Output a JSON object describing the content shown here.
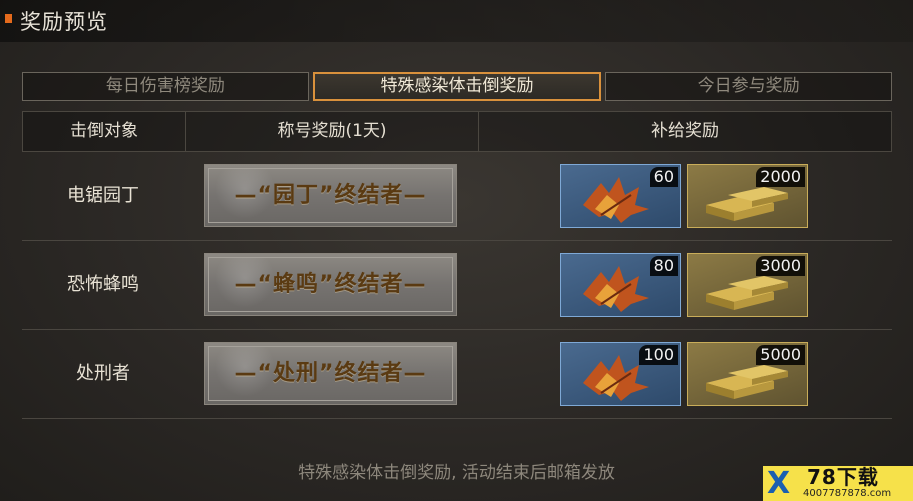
{
  "header": {
    "title": "奖励预览"
  },
  "tabs": [
    {
      "label": "每日伤害榜奖励",
      "active": false
    },
    {
      "label": "特殊感染体击倒奖励",
      "active": true
    },
    {
      "label": "今日参与奖励",
      "active": false
    }
  ],
  "table": {
    "headers": [
      "击倒对象",
      "称号奖励(1天)",
      "补给奖励"
    ],
    "rows": [
      {
        "target": "电锯园丁",
        "title": "—“园丁”终结者—",
        "leaf_count": "60",
        "gold_count": "2000"
      },
      {
        "target": "恐怖蜂鸣",
        "title": "—“蜂鸣”终结者—",
        "leaf_count": "80",
        "gold_count": "3000"
      },
      {
        "target": "处刑者",
        "title": "—“处刑”终结者—",
        "leaf_count": "100",
        "gold_count": "5000"
      }
    ]
  },
  "footer": {
    "note": "特殊感染体击倒奖励, 活动结束后邮箱发放"
  },
  "watermark": {
    "brand": "78下载",
    "x": "X",
    "sub": "4007787878.com"
  },
  "colors": {
    "accent": "#e46a1c",
    "active_tab_border": "#d9913c",
    "leaf_frame": "#7fa9d6",
    "gold_frame": "#c9ad5a"
  }
}
